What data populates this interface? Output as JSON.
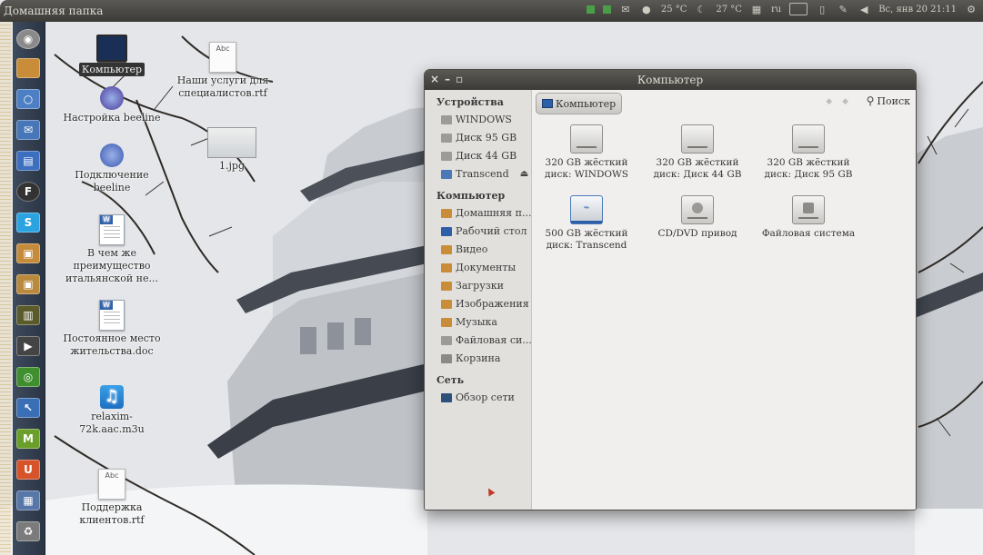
{
  "top_panel": {
    "app_title": "Домашняя папка",
    "indicators": {
      "temp1": "25 °C",
      "temp2": "27 °C",
      "keyboard": "ru",
      "datetime": "Вс, янв 20 21:11"
    }
  },
  "launcher": {
    "items": [
      {
        "icon": "ubuntu-logo-icon",
        "color": "#8a8a8a"
      },
      {
        "icon": "home-folder-icon",
        "color": "#c98d3a"
      },
      {
        "icon": "browser-icon",
        "color": "#4d7fc4"
      },
      {
        "icon": "mail-icon",
        "color": "#4777b9"
      },
      {
        "icon": "document-icon",
        "color": "#3c6fc0"
      },
      {
        "icon": "f-app-icon",
        "color": "#333333"
      },
      {
        "icon": "skype-icon",
        "color": "#2aa3e0"
      },
      {
        "icon": "package-icon",
        "color": "#c58b3b"
      },
      {
        "icon": "package-install-icon",
        "color": "#b9893d"
      },
      {
        "icon": "monitor-app-icon",
        "color": "#5a5a2a"
      },
      {
        "icon": "terminal-icon",
        "color": "#444444"
      },
      {
        "icon": "green-app-icon",
        "color": "#3f8f2e"
      },
      {
        "icon": "cursor-app-icon",
        "color": "#3a6fb6"
      },
      {
        "icon": "m-app-icon",
        "color": "#6a9f2a"
      },
      {
        "icon": "ubuntu-one-icon",
        "color": "#d7542b"
      },
      {
        "icon": "workspace-icon",
        "color": "#5877a9"
      },
      {
        "icon": "trash-icon",
        "color": "#7b7b7b"
      }
    ],
    "labels": {
      "f_app": "F",
      "skype": "S",
      "ubuntu_one": "U",
      "m_app": "M"
    }
  },
  "desktop": {
    "icons": [
      {
        "label": "Компьютер",
        "kind": "monitor"
      },
      {
        "label": "Наши услуги для специалистов.rtf",
        "kind": "abc"
      },
      {
        "label": "Настройка beeline",
        "kind": "network"
      },
      {
        "label": "1.jpg",
        "kind": "image"
      },
      {
        "label": "Подключение beeline",
        "kind": "network"
      },
      {
        "label": "В чем же преимущество итальянской не...",
        "kind": "doc"
      },
      {
        "label": "Постоянное место жительства.doc",
        "kind": "doc"
      },
      {
        "label": "relaxim-72k.aac.m3u",
        "kind": "music"
      },
      {
        "label": "Поддержка клиентов.rtf",
        "kind": "abc"
      }
    ],
    "abc_text": "Abc",
    "word_badge": "W",
    "music_glyph": "♫"
  },
  "window": {
    "title": "Компьютер",
    "controls": {
      "close": "×",
      "minimize": "–",
      "maximize": "▫"
    },
    "sidebar": {
      "devices_heading": "Устройства",
      "devices": [
        {
          "label": "WINDOWS",
          "color": "#9c9b98"
        },
        {
          "label": "Диск 95 GB",
          "color": "#9c9b98"
        },
        {
          "label": "Диск 44 GB",
          "color": "#9c9b98"
        },
        {
          "label": "Transcend",
          "color": "#4b79b8",
          "eject": "⏏"
        }
      ],
      "computer_heading": "Компьютер",
      "places": [
        {
          "label": "Домашняя п...",
          "color": "#c98d3a"
        },
        {
          "label": "Рабочий стол",
          "color": "#2d5fa8"
        },
        {
          "label": "Видео",
          "color": "#c98d3a"
        },
        {
          "label": "Документы",
          "color": "#c98d3a"
        },
        {
          "label": "Загрузки",
          "color": "#c98d3a"
        },
        {
          "label": "Изображения",
          "color": "#c98d3a"
        },
        {
          "label": "Музыка",
          "color": "#c98d3a"
        },
        {
          "label": "Файловая си...",
          "color": "#9c9b98"
        },
        {
          "label": "Корзина",
          "color": "#8b8a87"
        }
      ],
      "network_heading": "Сеть",
      "network": [
        {
          "label": "Обзор сети",
          "color": "#2d4f7a"
        }
      ]
    },
    "toolbar": {
      "crumb_label": "Компьютер",
      "nav_arrows": "◆ ◆",
      "search_icon": "⚲",
      "search_label": "Поиск"
    },
    "items": [
      {
        "label": "320 GB жёсткий диск: WINDOWS",
        "kind": "hdd"
      },
      {
        "label": "320 GB жёсткий диск: Диск 44 GB",
        "kind": "hdd"
      },
      {
        "label": "320 GB жёсткий диск: Диск 95 GB",
        "kind": "hdd"
      },
      {
        "label": "500 GB жёсткий диск: Transcend",
        "kind": "usb"
      },
      {
        "label": "CD/DVD привод",
        "kind": "cd"
      },
      {
        "label": "Файловая система",
        "kind": "fs"
      }
    ],
    "usb_symbol": "⌁"
  }
}
